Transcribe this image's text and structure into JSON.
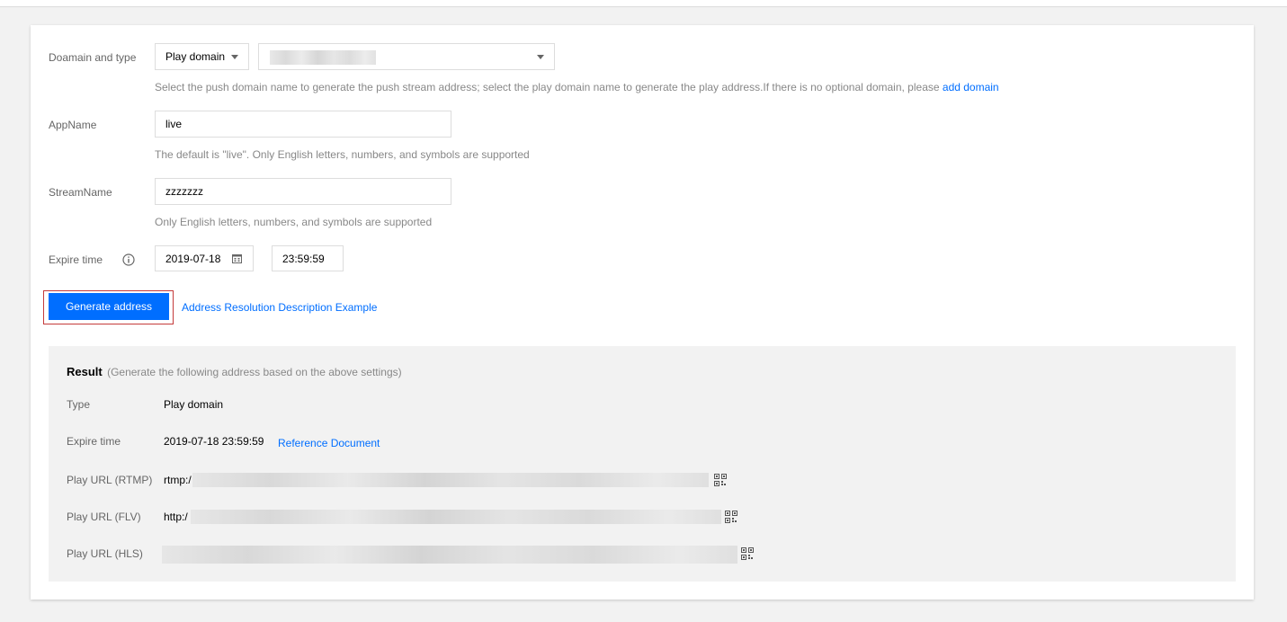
{
  "form": {
    "domain_label": "Doamain and type",
    "domain_type_value": "Play domain",
    "domain_hint": "Select the push domain name to generate the push stream address; select the play domain name to generate the play address.If there is no optional domain, please",
    "add_domain_link": "add domain",
    "appname_label": "AppName",
    "appname_value": "live",
    "appname_hint": "The default is \"live\". Only English letters, numbers, and symbols are supported",
    "streamname_label": "StreamName",
    "streamname_value": "zzzzzzz",
    "streamname_hint": "Only English letters, numbers, and symbols are supported",
    "expire_label": "Expire time",
    "expire_date": "2019-07-18",
    "expire_time": "23:59:59",
    "generate_button": "Generate address",
    "example_link": "Address Resolution Description Example"
  },
  "result": {
    "title": "Result",
    "subtitle": "(Generate the following address based on the above settings)",
    "type_label": "Type",
    "type_value": "Play domain",
    "expire_label": "Expire time",
    "expire_value": "2019-07-18 23:59:59",
    "reference_link": "Reference Document",
    "rtmp_label": "Play URL (RTMP)",
    "rtmp_prefix": "rtmp:/",
    "flv_label": "Play URL (FLV)",
    "flv_prefix": "http:/",
    "hls_label": "Play URL (HLS)"
  },
  "icons": [
    "info-icon",
    "calendar-icon",
    "caret-down-icon",
    "qr-code-icon"
  ],
  "colors": {
    "primary": "#006eff",
    "highlight_border": "#c43a3a",
    "result_bg": "#f2f2f2"
  }
}
